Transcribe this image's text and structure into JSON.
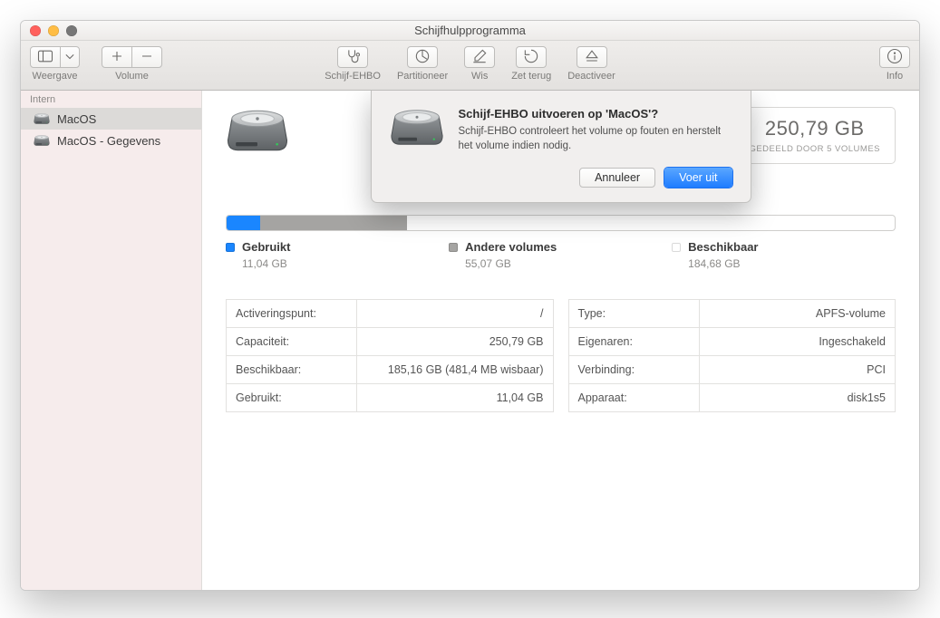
{
  "window": {
    "title": "Schijfhulpprogramma"
  },
  "toolbar": {
    "view_label": "Weergave",
    "volume_label": "Volume",
    "first_aid_label": "Schijf-EHBO",
    "partition_label": "Partitioneer",
    "erase_label": "Wis",
    "restore_label": "Zet terug",
    "unmount_label": "Deactiveer",
    "info_label": "Info"
  },
  "sidebar": {
    "section": "Intern",
    "items": [
      {
        "label": "MacOS",
        "selected": true
      },
      {
        "label": "MacOS - Gegevens",
        "selected": false
      }
    ]
  },
  "capacity": {
    "value": "250,79 GB",
    "subtitle": "GEDEELD DOOR 5 VOLUMES"
  },
  "usage": {
    "used_pct": 5,
    "other_pct": 22,
    "legend": {
      "used_label": "Gebruikt",
      "used_value": "11,04 GB",
      "other_label": "Andere volumes",
      "other_value": "55,07 GB",
      "free_label": "Beschikbaar",
      "free_value": "184,68 GB"
    }
  },
  "details": {
    "left": [
      {
        "k": "Activeringspunt:",
        "v": "/"
      },
      {
        "k": "Capaciteit:",
        "v": "250,79 GB"
      },
      {
        "k": "Beschikbaar:",
        "v": "185,16 GB (481,4 MB wisbaar)"
      },
      {
        "k": "Gebruikt:",
        "v": "11,04 GB"
      }
    ],
    "right": [
      {
        "k": "Type:",
        "v": "APFS-volume"
      },
      {
        "k": "Eigenaren:",
        "v": "Ingeschakeld"
      },
      {
        "k": "Verbinding:",
        "v": "PCI"
      },
      {
        "k": "Apparaat:",
        "v": "disk1s5"
      }
    ]
  },
  "dialog": {
    "title": "Schijf-EHBO uitvoeren op 'MacOS'?",
    "message": "Schijf-EHBO controleert het volume op fouten en herstelt het volume indien nodig.",
    "cancel": "Annuleer",
    "run": "Voer uit"
  }
}
